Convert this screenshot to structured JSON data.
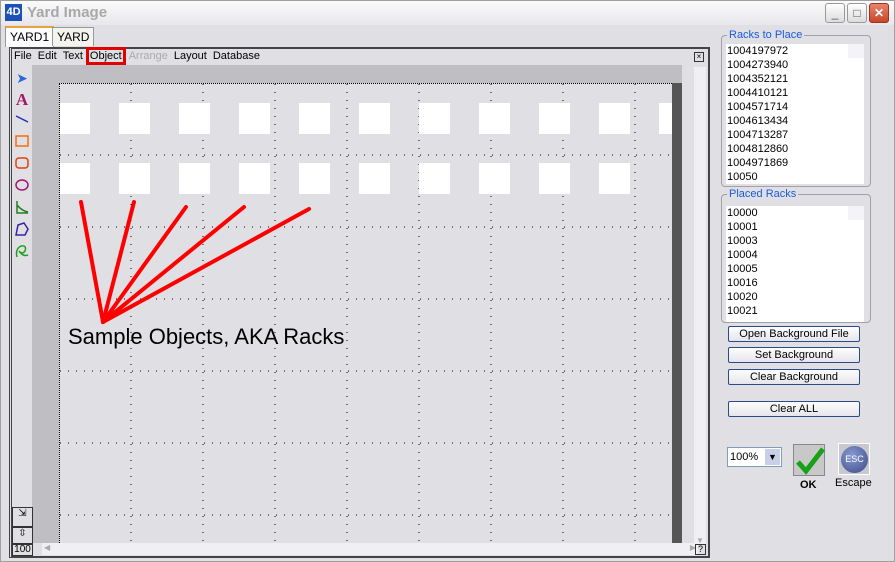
{
  "window": {
    "title": "Yard Image",
    "logo": "4D"
  },
  "tabs": [
    {
      "label": "YARD1",
      "active": true
    },
    {
      "label": "YARD",
      "active": false
    }
  ],
  "menu": {
    "items": [
      {
        "label": "File"
      },
      {
        "label": "Edit"
      },
      {
        "label": "Text"
      },
      {
        "label": "Object",
        "highlighted": true
      },
      {
        "label": "Arrange",
        "disabled": true
      },
      {
        "label": "Layout"
      },
      {
        "label": "Database"
      }
    ]
  },
  "tools": [
    "pointer-icon",
    "text-icon",
    "line-icon",
    "rectangle-icon",
    "rounded-rectangle-icon",
    "oval-icon",
    "polyline-icon",
    "polygon-icon",
    "freehand-icon"
  ],
  "canvas": {
    "annotation": "Sample Objects, AKA Racks",
    "annotation_color": "#ff0000",
    "row1_count": 11,
    "row2_count": 10,
    "zoom_readout": "100"
  },
  "racks_to_place": {
    "label": "Racks to Place",
    "items": [
      "1004197972",
      "1004273940",
      "1004352121",
      "1004410121",
      "1004571714",
      "1004613434",
      "1004713287",
      "1004812860",
      "1004971869",
      "10050"
    ]
  },
  "placed_racks": {
    "label": "Placed Racks",
    "items": [
      "10000",
      "10001",
      "10003",
      "10004",
      "10005",
      "10016",
      "10020",
      "10021"
    ]
  },
  "buttons": {
    "open_bg": "Open Background File",
    "set_bg": "Set Background",
    "clear_bg": "Clear Background",
    "clear_all": "Clear ALL"
  },
  "zoom_select": {
    "value": "100%"
  },
  "ok": {
    "label": "OK"
  },
  "escape": {
    "label": "Escape",
    "icon_text": "ESC"
  }
}
